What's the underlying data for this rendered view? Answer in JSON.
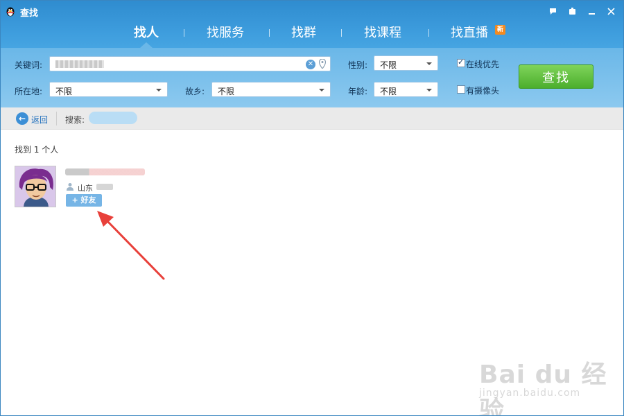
{
  "window": {
    "title": "查找",
    "colors": {
      "header": "#3c9bdc",
      "accent_green": "#4cae2c",
      "link_blue": "#1f6fbd"
    }
  },
  "tabs": [
    {
      "label": "找人",
      "active": true
    },
    {
      "label": "找服务",
      "active": false
    },
    {
      "label": "找群",
      "active": false
    },
    {
      "label": "找课程",
      "active": false
    },
    {
      "label": "找直播",
      "active": false,
      "badge": "新"
    }
  ],
  "filters": {
    "keyword_label": "关键词:",
    "gender_label": "性别:",
    "gender_value": "不限",
    "location_label": "所在地:",
    "location_value": "不限",
    "hometown_label": "故乡:",
    "hometown_value": "不限",
    "age_label": "年龄:",
    "age_value": "不限",
    "online_first_label": "在线优先",
    "online_first_checked": true,
    "has_camera_label": "有摄像头",
    "has_camera_checked": false,
    "search_button": "查找"
  },
  "subbar": {
    "back_label": "返回",
    "search_label": "搜索:"
  },
  "results": {
    "count_text": "找到 1 个人",
    "items": [
      {
        "location": "山东",
        "add_button": "+ 好友"
      }
    ]
  },
  "watermark": {
    "logo_text": "Bai du 经验",
    "url": "jingyan.baidu.com"
  }
}
